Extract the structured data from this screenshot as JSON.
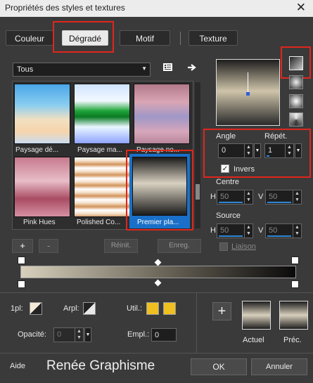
{
  "window": {
    "title": "Propriétés des styles et textures",
    "close": "✕"
  },
  "tabs": [
    {
      "label": "Couleur"
    },
    {
      "label": "Dégradé"
    },
    {
      "label": "Motif"
    },
    {
      "label": "Texture"
    }
  ],
  "filter": {
    "value": "Tous"
  },
  "gradients": [
    {
      "label": "Paysage dé..."
    },
    {
      "label": "Paysage ma..."
    },
    {
      "label": "Paysage no..."
    },
    {
      "label": "Pink Hues"
    },
    {
      "label": "Polished Co..."
    },
    {
      "label": "Premier pla..."
    }
  ],
  "list_buttons": {
    "add": "+",
    "remove": "-",
    "reset": "Réinit.",
    "save": "Enreg."
  },
  "settings": {
    "angle_label": "Angle",
    "angle_value": "0",
    "repeat_label": "Répét.",
    "repeat_value": "1",
    "invert_label": "Invers",
    "invert_checked": true,
    "centre_label": "Centre",
    "centre_h_label": "H",
    "centre_h": "50",
    "centre_v_label": "V",
    "centre_v": "50",
    "source_label": "Source",
    "source_h_label": "H",
    "source_h": "50",
    "source_v_label": "V",
    "source_v": "50",
    "link_label": "Liaison"
  },
  "bottom": {
    "opl_label": "1pl:",
    "arpl_label": "Arpl:",
    "util_label": "Util.:",
    "opacity_label": "Opacité:",
    "opacity_value": "0",
    "empl_label": "Empl.:",
    "empl_value": "0",
    "current_label": "Actuel",
    "previous_label": "Préc.",
    "add_symbol": "+"
  },
  "footer": {
    "help": "Aide",
    "watermark": "Renée Graphisme",
    "ok": "OK",
    "cancel": "Annuler"
  },
  "colors": {
    "accent": "#2f86d6",
    "highlight": "#e0261d",
    "util_swatch": "#f0c020",
    "selection": "#1a70c8"
  }
}
